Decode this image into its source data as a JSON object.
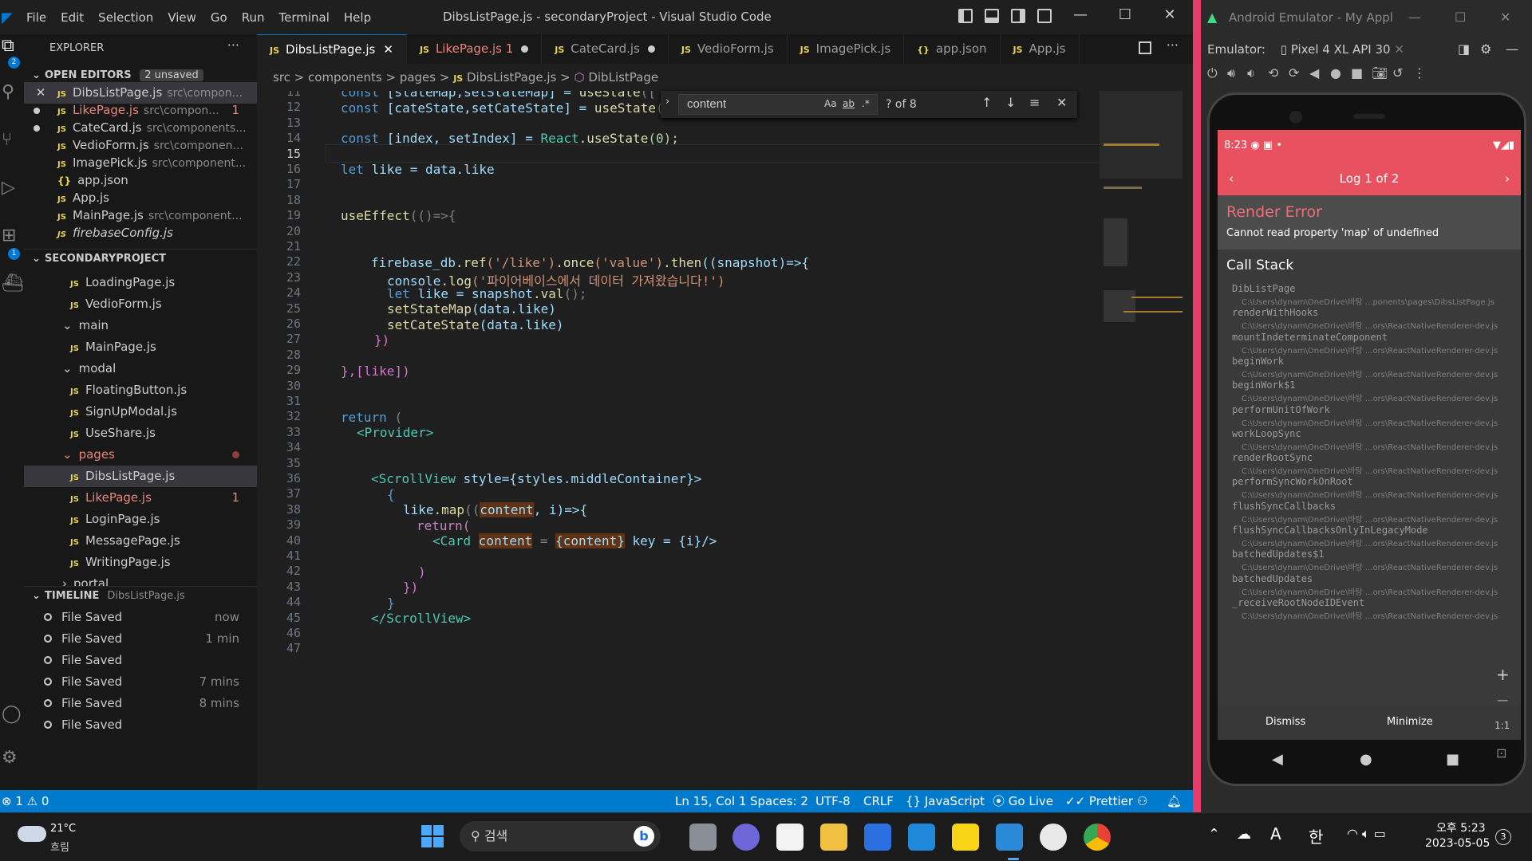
{
  "vscode": {
    "menu": [
      "File",
      "Edit",
      "Selection",
      "View",
      "Go",
      "Run",
      "Terminal",
      "Help"
    ],
    "title": "DibsListPage.js - secondaryProject - Visual Studio Code",
    "sidebar": {
      "header": "EXPLORER",
      "open_editors": {
        "label": "OPEN EDITORS",
        "badge": "2 unsaved",
        "items": [
          {
            "name": "DibsListPage.js",
            "desc": "src\\compon..."
          },
          {
            "name": "LikePage.js",
            "desc": "src\\compon...",
            "count": "1"
          },
          {
            "name": "CateCard.js",
            "desc": "src\\components..."
          },
          {
            "name": "VedioForm.js",
            "desc": "src\\componen..."
          },
          {
            "name": "ImagePick.js",
            "desc": "src\\component..."
          },
          {
            "name": "app.json",
            "desc": ""
          },
          {
            "name": "App.js",
            "desc": ""
          },
          {
            "name": "MainPage.js",
            "desc": "src\\component..."
          },
          {
            "name": "firebaseConfig.js",
            "desc": ""
          }
        ]
      },
      "project": {
        "label": "SECONDARYPROJECT",
        "items": [
          {
            "name": "LoadingPage.js",
            "type": "file"
          },
          {
            "name": "VedioForm.js",
            "type": "file"
          },
          {
            "name": "main",
            "type": "folder"
          },
          {
            "name": "MainPage.js",
            "type": "file"
          },
          {
            "name": "modal",
            "type": "folder"
          },
          {
            "name": "FloatingButton.js",
            "type": "file"
          },
          {
            "name": "SignUpModal.js",
            "type": "file"
          },
          {
            "name": "UseShare.js",
            "type": "file"
          },
          {
            "name": "pages",
            "type": "folder"
          },
          {
            "name": "DibsListPage.js",
            "type": "file"
          },
          {
            "name": "LikePage.js",
            "type": "file",
            "count": "1"
          },
          {
            "name": "LoginPage.js",
            "type": "file"
          },
          {
            "name": "MessagePage.js",
            "type": "file"
          },
          {
            "name": "WritingPage.js",
            "type": "file"
          },
          {
            "name": "portal",
            "type": "folder"
          }
        ]
      },
      "timeline": {
        "label": "TIMELINE",
        "file": "DibsListPage.js",
        "items": [
          {
            "label": "File Saved",
            "time": "now"
          },
          {
            "label": "File Saved",
            "time": "1 min"
          },
          {
            "label": "File Saved",
            "time": ""
          },
          {
            "label": "File Saved",
            "time": "7 mins"
          },
          {
            "label": "File Saved",
            "time": "8 mins"
          },
          {
            "label": "File Saved",
            "time": ""
          }
        ]
      }
    },
    "tabs": [
      {
        "label": "DibsListPage.js"
      },
      {
        "label": "LikePage.js",
        "count": "1"
      },
      {
        "label": "CateCard.js"
      },
      {
        "label": "VedioForm.js"
      },
      {
        "label": "ImagePick.js"
      },
      {
        "label": "app.json"
      },
      {
        "label": "App.js"
      }
    ],
    "breadcrumb": [
      "src",
      "components",
      "pages",
      "DibsListPage.js",
      "DibListPage"
    ],
    "find": {
      "value": "content",
      "count": "? of 8",
      "aa": "Aa",
      "ab": "ab",
      "regex": ".*"
    },
    "code_lines": [
      "11",
      "12",
      "13",
      "14",
      "15",
      "16",
      "17",
      "18",
      "19",
      "20",
      "21",
      "22",
      "23",
      "24",
      "25",
      "26",
      "27",
      "28",
      "29",
      "30",
      "31",
      "32",
      "33",
      "34",
      "35",
      "36",
      "37",
      "38",
      "39",
      "40",
      "41",
      "42",
      "43",
      "44",
      "45",
      "46",
      "47"
    ],
    "code": {
      "l11a": "const ",
      "l11b": "[stateMap,setStateMap] = ",
      "l11c": "useState",
      "l11d": "([",
      "l12a": "const ",
      "l12b": "[cateState,setCateState] = ",
      "l12c": "useState",
      "l12d": "([])",
      "l14a": "const ",
      "l14b": "[index, setIndex] = ",
      "l14c": "React",
      "l14d": ".useState",
      "l14e": "(0);",
      "l16a": "let ",
      "l16b": "like = data.like",
      "l19a": "useEffect",
      "l19b": "(()=>{",
      "l22a": "firebase_db",
      "l22b": ".ref",
      "l22c": "('/like')",
      "l22d": ".once",
      "l22e": "('value')",
      "l22f": ".then",
      "l22g": "((snapshot)=>{",
      "l23a": "console",
      "l23b": ".log",
      "l23c": "('파이어베이스에서 데이터 가져왔습니다!')",
      "l24a": "let ",
      "l24b": "like = ",
      "l24c": "snapshot",
      "l24d": ".val",
      "l24e": "();",
      "l25a": "setStateMap",
      "l25b": "(data.like)",
      "l26a": "setCateState",
      "l26b": "(data.like)",
      "l27": "})",
      "l29": "},[like])",
      "l32a": "return ",
      "l32b": "(",
      "l33": "<Provider>",
      "l36a": "<ScrollView ",
      "l36b": "style",
      "l36c": "={styles.middleContainer}>",
      "l37": "{",
      "l38a": "like",
      "l38b": ".map",
      "l38c": "((",
      "l38d": "content",
      "l38e": ", i)=>{",
      "l39": "return(",
      "l40a": "<Card ",
      "l40b": "content",
      "l40c": " = ",
      "l40d": "{content}",
      "l40e": " key = {i}/>",
      "l42": ")",
      "l43": "})",
      "l44": "}",
      "l45": "</ScrollView>"
    },
    "status": {
      "errors": "1",
      "warnings": "0",
      "position": "Ln 15, Col 1",
      "spaces": "Spaces: 2",
      "encoding": "UTF-8",
      "eol": "CRLF",
      "language": "JavaScript",
      "golive": "Go Live",
      "prettier": "Prettier"
    }
  },
  "emulator": {
    "title": "Android Emulator - My Appl",
    "label": "Emulator:",
    "device": "Pixel 4 XL API 30",
    "phone": {
      "time": "8:23",
      "log": "Log 1 of 2",
      "error_title": "Render Error",
      "error_msg": "Cannot read property 'map' of undefined",
      "callstack_label": "Call Stack",
      "frames": [
        {
          "fn": "DibListPage",
          "path": "C:\\Users\\dynam\\OneDrive\\바탕 ...ponents\\pages\\DibsListPage.js"
        },
        {
          "fn": "renderWithHooks",
          "path": "C:\\Users\\dynam\\OneDrive\\바탕 ...ors\\ReactNativeRenderer-dev.js"
        },
        {
          "fn": "mountIndeterminateComponent",
          "path": "C:\\Users\\dynam\\OneDrive\\바탕 ...ors\\ReactNativeRenderer-dev.js"
        },
        {
          "fn": "beginWork",
          "path": "C:\\Users\\dynam\\OneDrive\\바탕 ...ors\\ReactNativeRenderer-dev.js"
        },
        {
          "fn": "beginWork$1",
          "path": "C:\\Users\\dynam\\OneDrive\\바탕 ...ors\\ReactNativeRenderer-dev.js"
        },
        {
          "fn": "performUnitOfWork",
          "path": "C:\\Users\\dynam\\OneDrive\\바탕 ...ors\\ReactNativeRenderer-dev.js"
        },
        {
          "fn": "workLoopSync",
          "path": "C:\\Users\\dynam\\OneDrive\\바탕 ...ors\\ReactNativeRenderer-dev.js"
        },
        {
          "fn": "renderRootSync",
          "path": "C:\\Users\\dynam\\OneDrive\\바탕 ...ors\\ReactNativeRenderer-dev.js"
        },
        {
          "fn": "performSyncWorkOnRoot",
          "path": "C:\\Users\\dynam\\OneDrive\\바탕 ...ors\\ReactNativeRenderer-dev.js"
        },
        {
          "fn": "flushSyncCallbacks",
          "path": "C:\\Users\\dynam\\OneDrive\\바탕 ...ors\\ReactNativeRenderer-dev.js"
        },
        {
          "fn": "flushSyncCallbacksOnlyInLegacyMode",
          "path": "C:\\Users\\dynam\\OneDrive\\바탕 ...ors\\ReactNativeRenderer-dev.js"
        },
        {
          "fn": "batchedUpdates$1",
          "path": "C:\\Users\\dynam\\OneDrive\\바탕 ...ors\\ReactNativeRenderer-dev.js"
        },
        {
          "fn": "batchedUpdates",
          "path": "C:\\Users\\dynam\\OneDrive\\바탕 ...ors\\ReactNativeRenderer-dev.js"
        },
        {
          "fn": "_receiveRootNodeIDEvent",
          "path": "C:\\Users\\dynam\\OneDrive\\바탕 ...ors\\ReactNativeRenderer-dev.js"
        }
      ],
      "dismiss": "Dismiss",
      "minimize": "Minimize"
    },
    "zoom": "1:1"
  },
  "taskbar": {
    "temp": "21°C",
    "weather": "흐림",
    "search": "검색",
    "ime_a": "A",
    "ime_han": "한",
    "clock_time": "오후 5:23",
    "clock_date": "2023-05-05",
    "notif": "3"
  },
  "colors": {
    "accent": "#007acc",
    "emulator_accent": "#e8515f",
    "error_title": "#ee6d77"
  }
}
